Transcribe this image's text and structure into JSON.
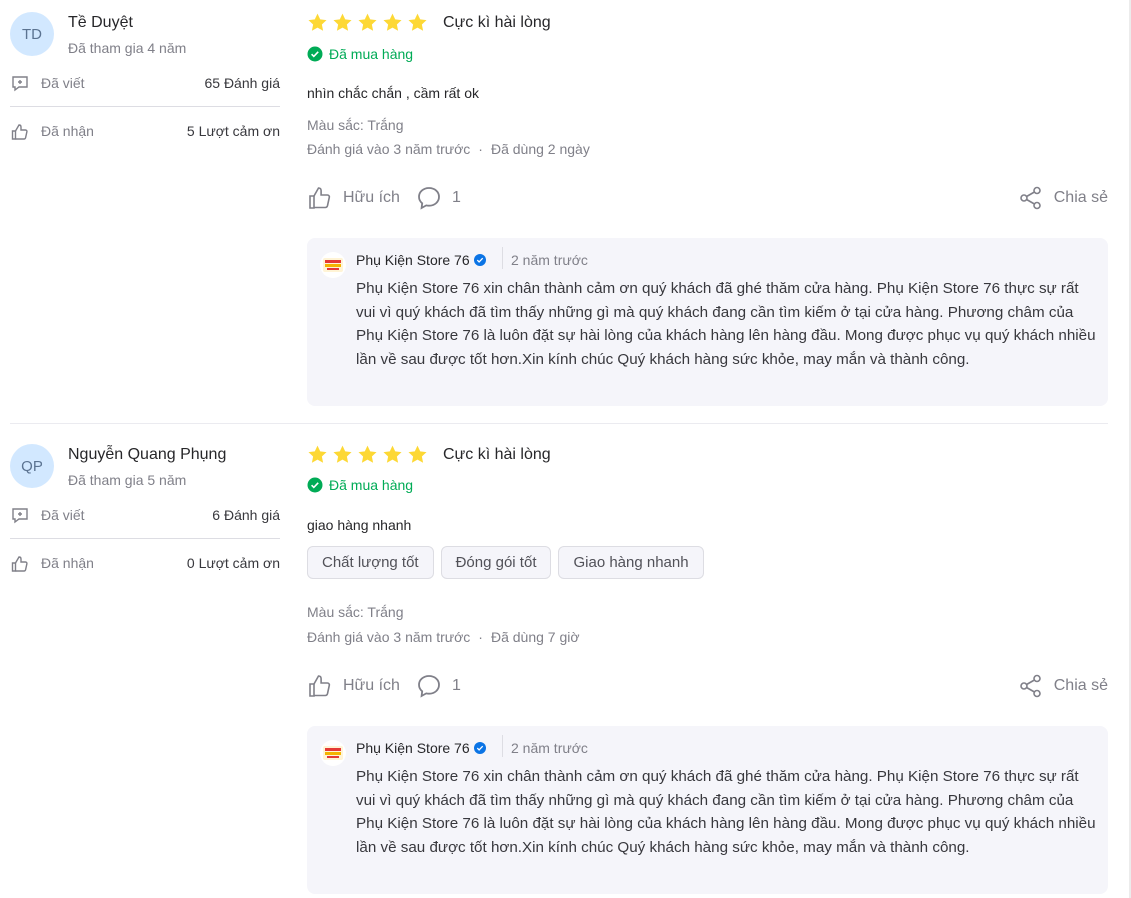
{
  "reviews": [
    {
      "user": {
        "initials": "TD",
        "name": "Tề Duyệt",
        "joined": "Đã tham gia 4 năm",
        "written_label": "Đã viết",
        "written_value": "65 Đánh giá",
        "received_label": "Đã nhận",
        "received_value": "5 Lượt cảm ơn"
      },
      "rating": 5,
      "rating_title": "Cực kì hài lòng",
      "purchased": "Đã mua hàng",
      "comment": "nhìn chắc chắn , cầm rất ok",
      "chips": [],
      "color": "Màu sắc: Trắng",
      "reviewed": "Đánh giá vào 3 năm trước",
      "used": "Đã dùng 2 ngày",
      "helpful": "Hữu ích",
      "comment_count": "1",
      "share": "Chia sẻ",
      "reply": {
        "seller": "Phụ Kiện Store 76",
        "time": "2 năm trước",
        "text": "Phụ Kiện Store 76 xin chân thành cảm ơn quý khách đã ghé thăm cửa hàng. Phụ Kiện Store 76 thực sự rất vui vì quý khách đã tìm thấy những gì mà quý khách đang cần tìm kiếm ở tại cửa hàng. Phương châm của Phụ Kiện Store 76 là luôn đặt sự hài lòng của khách hàng lên hàng đầu. Mong được phục vụ quý khách nhiều lần về sau được tốt hơn.Xin kính chúc Quý khách hàng sức khỏe, may mắn và thành công."
      }
    },
    {
      "user": {
        "initials": "QP",
        "name": "Nguyễn Quang Phụng",
        "joined": "Đã tham gia 5 năm",
        "written_label": "Đã viết",
        "written_value": "6 Đánh giá",
        "received_label": "Đã nhận",
        "received_value": "0 Lượt cảm ơn"
      },
      "rating": 5,
      "rating_title": "Cực kì hài lòng",
      "purchased": "Đã mua hàng",
      "comment": "giao hàng nhanh",
      "chips": [
        "Chất lượng tốt",
        "Đóng gói tốt",
        "Giao hàng nhanh"
      ],
      "color": "Màu sắc: Trắng",
      "reviewed": "Đánh giá vào 3 năm trước",
      "used": "Đã dùng 7 giờ",
      "helpful": "Hữu ích",
      "comment_count": "1",
      "share": "Chia sẻ",
      "reply": {
        "seller": "Phụ Kiện Store 76",
        "time": "2 năm trước",
        "text": "Phụ Kiện Store 76 xin chân thành cảm ơn quý khách đã ghé thăm cửa hàng. Phụ Kiện Store 76 thực sự rất vui vì quý khách đã tìm thấy những gì mà quý khách đang cần tìm kiếm ở tại cửa hàng. Phương châm của Phụ Kiện Store 76 là luôn đặt sự hài lòng của khách hàng lên hàng đầu. Mong được phục vụ quý khách nhiều lần về sau được tốt hơn.Xin kính chúc Quý khách hàng sức khỏe, may mắn và thành công."
      }
    }
  ],
  "colors": {
    "star": "#fdd835",
    "bought": "#00ab56",
    "verified": "#0b74e5",
    "avatar_bg": "#d2e8ff",
    "reply_bg": "#f5f5fa"
  },
  "icons": [
    "written-review-icon",
    "thumbs-up-icon",
    "star-icon",
    "check-circle-icon",
    "comment-bubble-icon",
    "share-icon",
    "verified-badge-icon",
    "seller-logo-icon"
  ]
}
